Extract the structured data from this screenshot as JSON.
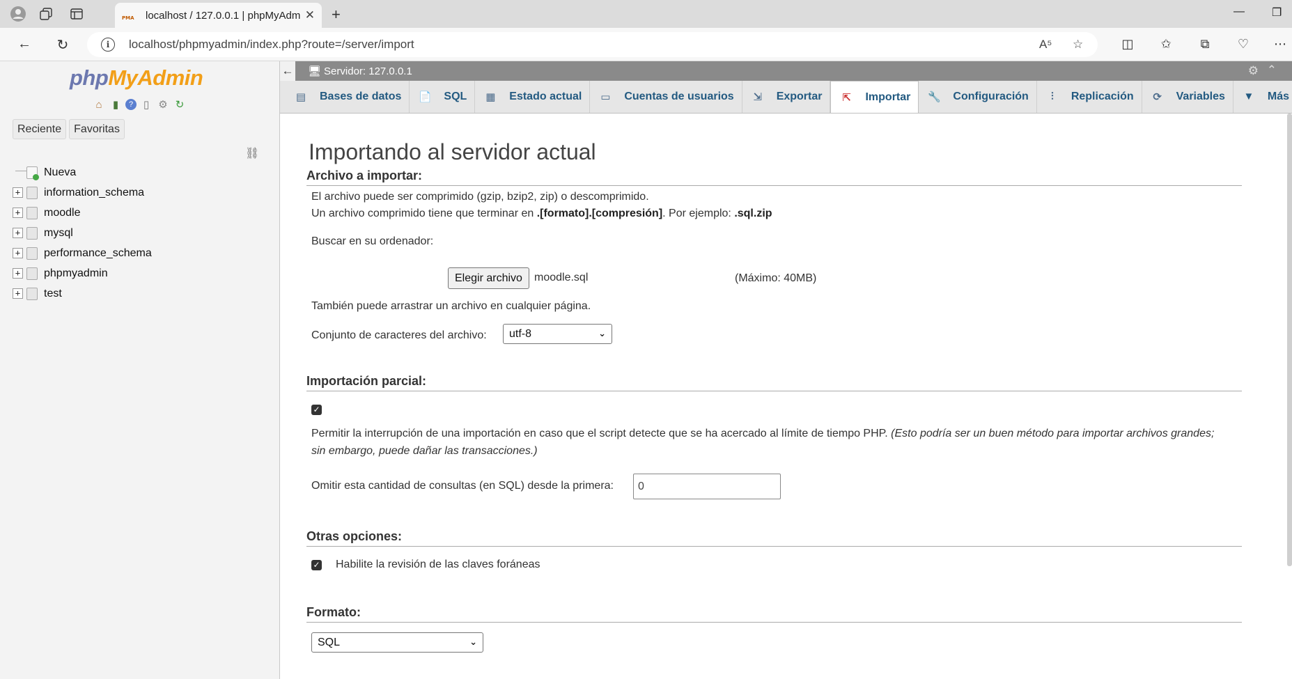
{
  "browser": {
    "tab_title": "localhost / 127.0.0.1 | phpMyAdmin",
    "tab_favicon_text": "PMA",
    "url": "localhost/phpmyadmin/index.php?route=/server/import",
    "read_aloud_label": "A⁵"
  },
  "sidebar": {
    "logo_php": "php",
    "logo_myadmin": "MyAdmin",
    "tabs": [
      "Reciente",
      "Favoritas"
    ],
    "tree": [
      {
        "label": "Nueva",
        "expander": ""
      },
      {
        "label": "information_schema",
        "expander": "+"
      },
      {
        "label": "moodle",
        "expander": "+"
      },
      {
        "label": "mysql",
        "expander": "+"
      },
      {
        "label": "performance_schema",
        "expander": "+"
      },
      {
        "label": "phpmyadmin",
        "expander": "+"
      },
      {
        "label": "test",
        "expander": "+"
      }
    ]
  },
  "server_bar": {
    "label": "Servidor: 127.0.0.1"
  },
  "menu": {
    "tabs": [
      {
        "label": "Bases de datos",
        "icon": "database-icon"
      },
      {
        "label": "SQL",
        "icon": "sql-icon"
      },
      {
        "label": "Estado actual",
        "icon": "status-icon"
      },
      {
        "label": "Cuentas de usuarios",
        "icon": "users-icon"
      },
      {
        "label": "Exportar",
        "icon": "export-icon"
      },
      {
        "label": "Importar",
        "icon": "import-icon",
        "active": true
      },
      {
        "label": "Configuración",
        "icon": "wrench-icon"
      },
      {
        "label": "Replicación",
        "icon": "replication-icon"
      },
      {
        "label": "Variables",
        "icon": "variables-icon"
      },
      {
        "label": "Más",
        "icon": "chevron-down-icon"
      }
    ]
  },
  "main": {
    "title": "Importando al servidor actual",
    "file_section": {
      "heading": "Archivo a importar:",
      "line1": "El archivo puede ser comprimido (gzip, bzip2, zip) o descomprimido.",
      "line2_pre": "Un archivo comprimido tiene que terminar en ",
      "line2_bold": ".[formato].[compresión]",
      "line2_mid": ". Por ejemplo: ",
      "line2_example": ".sql.zip",
      "browse_label": "Buscar en su ordenador:",
      "choose_button": "Elegir archivo",
      "chosen_file": "moodle.sql",
      "max_size": "(Máximo: 40MB)",
      "drag_hint": "También puede arrastrar un archivo en cualquier página.",
      "charset_label": "Conjunto de caracteres del archivo:",
      "charset_value": "utf-8"
    },
    "partial_section": {
      "heading": "Importación parcial:",
      "allow_interrupt_checked": true,
      "allow_interrupt_text": "Permitir la interrupción de una importación en caso que el script detecte que se ha acercado al límite de tiempo PHP. ",
      "allow_interrupt_note_1": "(Esto podría ser un buen método para importar archivos grandes;",
      "allow_interrupt_note_2": "sin embargo, puede dañar las transacciones.)",
      "skip_label": "Omitir esta cantidad de consultas (en SQL) desde la primera:",
      "skip_value": "0"
    },
    "other_section": {
      "heading": "Otras opciones:",
      "fk_checked": true,
      "fk_label": "Habilite la revisión de las claves foráneas"
    },
    "format_section": {
      "heading": "Formato:",
      "format_value": "SQL"
    }
  },
  "colors": {
    "link_blue": "#235a81",
    "logo_php": "#6c78af",
    "logo_myadmin": "#f29f18",
    "server_bar": "#8a8a8a"
  }
}
